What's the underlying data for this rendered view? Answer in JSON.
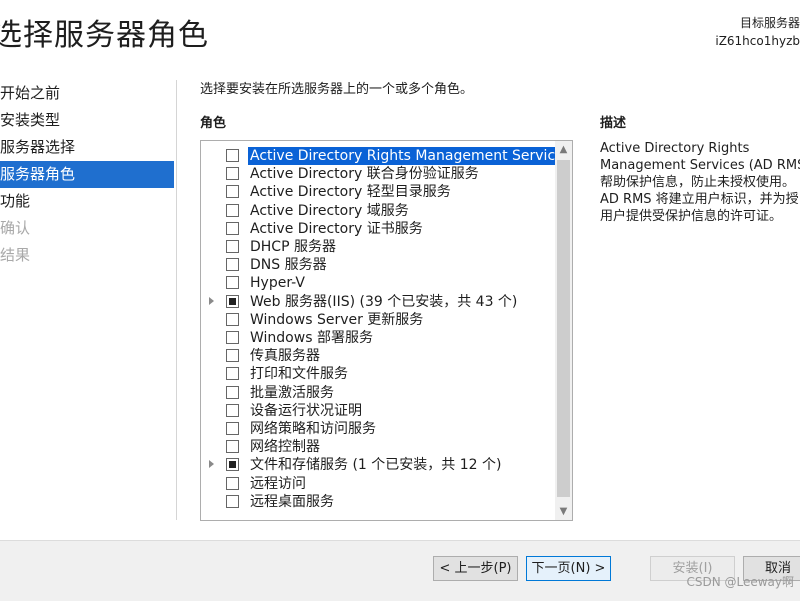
{
  "title": "选择服务器角色",
  "target": {
    "label": "目标服务器",
    "server": "iZ61hco1hyzb"
  },
  "nav": {
    "items": [
      {
        "label": "开始之前",
        "state": "normal"
      },
      {
        "label": "安装类型",
        "state": "normal"
      },
      {
        "label": "服务器选择",
        "state": "normal"
      },
      {
        "label": "服务器角色",
        "state": "active"
      },
      {
        "label": "功能",
        "state": "normal"
      },
      {
        "label": "确认",
        "state": "disabled"
      },
      {
        "label": "结果",
        "state": "disabled"
      }
    ]
  },
  "instruction": "选择要安装在所选服务器上的一个或多个角色。",
  "roles_header": "角色",
  "description_header": "描述",
  "roles": [
    {
      "label": "Active Directory Rights Management Services",
      "checked": "none",
      "expandable": false,
      "selected": true
    },
    {
      "label": "Active Directory 联合身份验证服务",
      "checked": "none",
      "expandable": false
    },
    {
      "label": "Active Directory 轻型目录服务",
      "checked": "none",
      "expandable": false
    },
    {
      "label": "Active Directory 域服务",
      "checked": "none",
      "expandable": false
    },
    {
      "label": "Active Directory 证书服务",
      "checked": "none",
      "expandable": false
    },
    {
      "label": "DHCP 服务器",
      "checked": "none",
      "expandable": false
    },
    {
      "label": "DNS 服务器",
      "checked": "none",
      "expandable": false
    },
    {
      "label": "Hyper-V",
      "checked": "none",
      "expandable": false
    },
    {
      "label": "Web 服务器(IIS) (39 个已安装，共 43 个)",
      "checked": "partial",
      "expandable": true
    },
    {
      "label": "Windows Server 更新服务",
      "checked": "none",
      "expandable": false
    },
    {
      "label": "Windows 部署服务",
      "checked": "none",
      "expandable": false
    },
    {
      "label": "传真服务器",
      "checked": "none",
      "expandable": false
    },
    {
      "label": "打印和文件服务",
      "checked": "none",
      "expandable": false
    },
    {
      "label": "批量激活服务",
      "checked": "none",
      "expandable": false
    },
    {
      "label": "设备运行状况证明",
      "checked": "none",
      "expandable": false
    },
    {
      "label": "网络策略和访问服务",
      "checked": "none",
      "expandable": false
    },
    {
      "label": "网络控制器",
      "checked": "none",
      "expandable": false
    },
    {
      "label": "文件和存储服务 (1 个已安装，共 12 个)",
      "checked": "partial",
      "expandable": true
    },
    {
      "label": "远程访问",
      "checked": "none",
      "expandable": false
    },
    {
      "label": "远程桌面服务",
      "checked": "none",
      "expandable": false
    }
  ],
  "description_lines": [
    "Active Directory Rights",
    "Management Services (AD RMS",
    "帮助保护信息，防止未授权使用。",
    "AD RMS 将建立用户标识，并为授",
    "用户提供受保护信息的许可证。"
  ],
  "buttons": {
    "previous": "< 上一步(P)",
    "next": "下一页(N) >",
    "install": "安装(I)",
    "cancel": "取消"
  },
  "watermark": "CSDN @Leeway啊",
  "colors": {
    "accent": "#1f6fcf",
    "selection": "#0a62d6"
  }
}
